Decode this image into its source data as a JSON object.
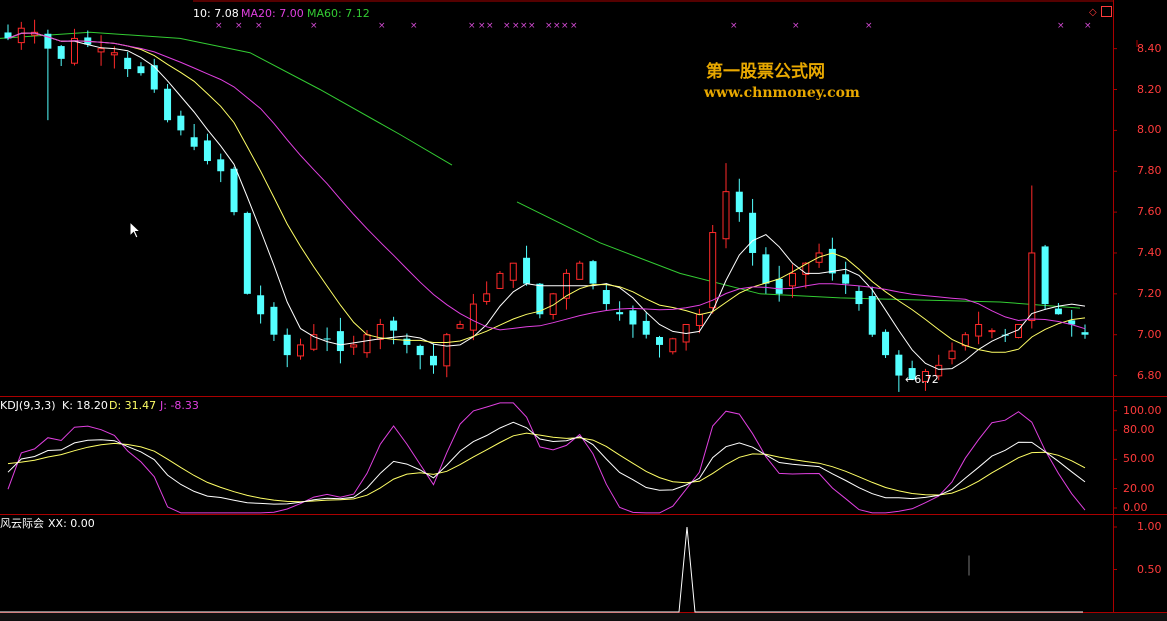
{
  "colors": {
    "up": "#ff2a2a",
    "down": "#54ffff",
    "ma5": "#ffffff",
    "ma10": "#ffff66",
    "ma20": "#e040e0",
    "ma60": "#33cc33",
    "border": "#aa0000",
    "axis_text": "#ff3b3b",
    "watermark": "#e8a800"
  },
  "main_header": {
    "ma10": "10: 7.08",
    "ma20": "MA20: 7.00",
    "ma60": "MA60: 7.12",
    "marker_glyph": "×"
  },
  "watermark": {
    "line1": "第一股票公式网",
    "line2": "www.chnmoney.com"
  },
  "price_axis": [
    "8.40",
    "8.20",
    "8.00",
    "7.80",
    "7.60",
    "7.40",
    "7.20",
    "7.00",
    "6.80"
  ],
  "low_annotation": "6.72",
  "kdj_header": {
    "name": "KDJ(9,3,3)",
    "k": "K: 18.20",
    "d": "D: 31.47",
    "j": "J: -8.33"
  },
  "kdj_axis": [
    "100.00",
    "80.00",
    "50.00",
    "20.00",
    "0.00"
  ],
  "bottom_header": {
    "name": "风云际会",
    "xx": "XX: 0.00"
  },
  "bottom_axis": [
    "1.00",
    "0.50"
  ],
  "toolbar_icons": [
    "diamond-icon",
    "square-icon"
  ],
  "chart_data": {
    "type": "candlestick",
    "price_range": [
      6.7,
      8.55
    ],
    "closes_approx": [
      8.45,
      8.5,
      8.48,
      8.4,
      8.35,
      8.45,
      8.42,
      8.4,
      8.38,
      8.3,
      8.28,
      8.2,
      8.05,
      8.0,
      7.92,
      7.85,
      7.8,
      7.6,
      7.2,
      7.1,
      7.0,
      6.9,
      6.95,
      7.0,
      6.98,
      6.92,
      6.95,
      7.0,
      7.05,
      7.02,
      6.95,
      6.9,
      6.85,
      7.0,
      7.05,
      7.15,
      7.2,
      7.3,
      7.35,
      7.25,
      7.1,
      7.2,
      7.3,
      7.35,
      7.25,
      7.15,
      7.1,
      7.05,
      7.0,
      6.95,
      6.98,
      7.05,
      7.1,
      7.5,
      7.7,
      7.6,
      7.4,
      7.25,
      7.2,
      7.3,
      7.35,
      7.4,
      7.3,
      7.25,
      7.15,
      7.0,
      6.9,
      6.8,
      6.78,
      6.82,
      6.85,
      6.92,
      7.0,
      7.05,
      7.02,
      7.0,
      7.05,
      7.4,
      7.15,
      7.1,
      7.05,
      7.0
    ],
    "kdj_range": [
      0,
      110
    ],
    "xx_spike_at_fraction": 0.59
  }
}
